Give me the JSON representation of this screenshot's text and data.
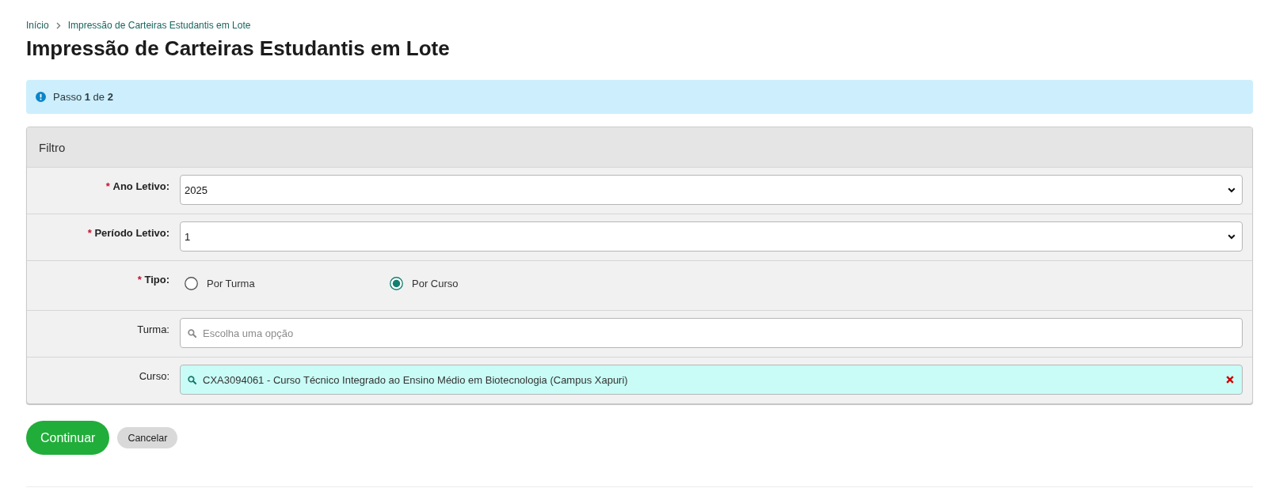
{
  "breadcrumb": [
    {
      "label": "Início"
    },
    {
      "label": "Impressão de Carteiras Estudantis em Lote"
    }
  ],
  "title": "Impressão de Carteiras Estudantis em Lote",
  "alert": {
    "text": "Passo **1** de **2**"
  },
  "panel": {
    "title": "Filtro",
    "fields": [
      {
        "kind": "select",
        "label": "Ano Letivo:",
        "required": true,
        "required_mark": "*",
        "value": "2025"
      },
      {
        "kind": "select",
        "label": "Período Letivo:",
        "required": true,
        "required_mark": "*",
        "value": "1"
      },
      {
        "kind": "radio",
        "label": "Tipo:",
        "required": true,
        "required_mark": "*",
        "options": [
          {
            "label": "Por Turma",
            "selected": false
          },
          {
            "label": "Por Curso",
            "selected": true
          }
        ]
      },
      {
        "kind": "search",
        "label": "Turma:",
        "required": false,
        "placeholder": "Escolha uma opção"
      },
      {
        "kind": "search",
        "label": "Curso:",
        "required": false,
        "value": "CXA3094061 - Curso Técnico Integrado ao Ensino Médio em Biotecnologia (Campus Xapuri)"
      }
    ]
  },
  "buttons": [
    {
      "label": "Continuar",
      "kind": "primary"
    },
    {
      "label": "Cancelar",
      "kind": "secondary"
    }
  ]
}
